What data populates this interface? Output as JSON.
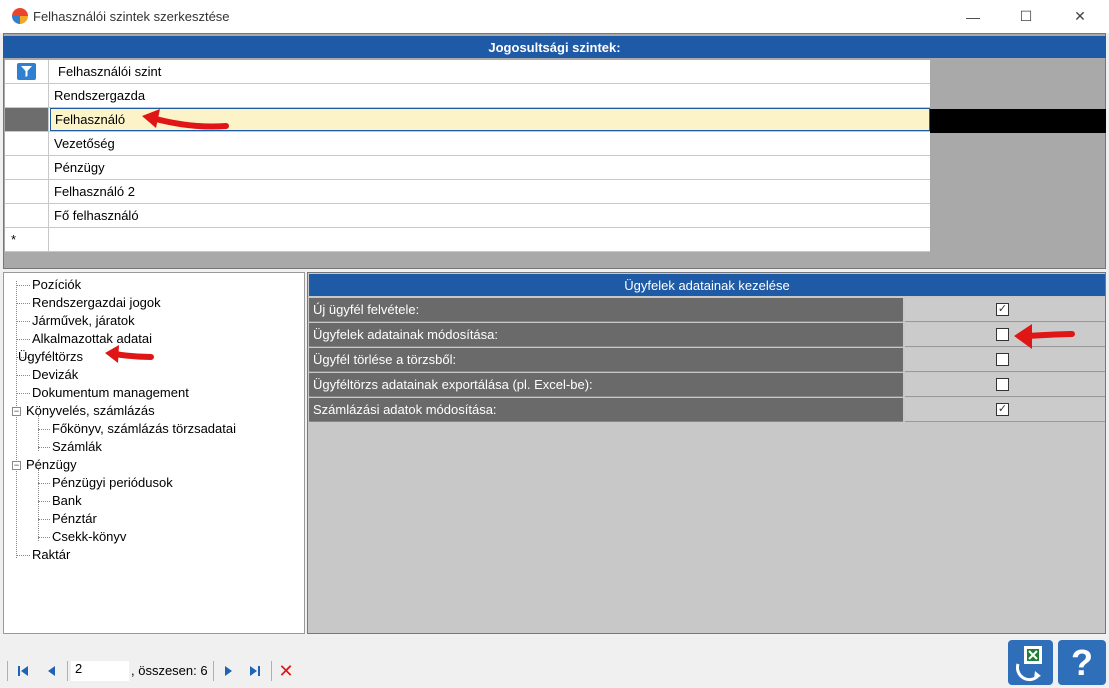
{
  "window": {
    "title": "Felhasználói szintek szerkesztése",
    "minimize_glyph": "—",
    "maximize_glyph": "☐",
    "close_glyph": "✕"
  },
  "grid": {
    "header": "Jogosultsági szintek:",
    "column_header": "Felhasználói szint",
    "rows": [
      "Rendszergazda",
      "Felhasználó",
      "Vezetőség",
      "Pénzügy",
      "Felhasználó 2",
      "Fő felhasználó"
    ],
    "selected_index": 1,
    "new_row_marker": "*"
  },
  "tree": {
    "items": [
      {
        "label": "Pozíciók",
        "level": 0
      },
      {
        "label": "Rendszergazdai jogok",
        "level": 0
      },
      {
        "label": "Járművek, járatok",
        "level": 0
      },
      {
        "label": "Alkalmazottak adatai",
        "level": 0
      },
      {
        "label": "Ügyféltörzs",
        "level": 0
      },
      {
        "label": "Devizák",
        "level": 0
      },
      {
        "label": "Dokumentum management",
        "level": 0
      },
      {
        "label": "Könyvelés, számlázás",
        "level": 0,
        "expanded": true
      },
      {
        "label": "Főkönyv, számlázás törzsadatai",
        "level": 1
      },
      {
        "label": "Számlák",
        "level": 1
      },
      {
        "label": "Pénzügy",
        "level": 0,
        "expanded": true
      },
      {
        "label": "Pénzügyi periódusok",
        "level": 1
      },
      {
        "label": "Bank",
        "level": 1
      },
      {
        "label": "Pénztár",
        "level": 1
      },
      {
        "label": "Csekk-könyv",
        "level": 1
      },
      {
        "label": "Raktár",
        "level": 0
      }
    ]
  },
  "permissions": {
    "header": "Ügyfelek adatainak kezelése",
    "rows": [
      {
        "label": "Új ügyfél felvétele:",
        "checked": true
      },
      {
        "label": "Ügyfelek adatainak módosítása:",
        "checked": false
      },
      {
        "label": "Ügyfél törlése a törzsből:",
        "checked": false
      },
      {
        "label": "Ügyféltörzs adatainak exportálása (pl. Excel-be):",
        "checked": false
      },
      {
        "label": "Számlázási adatok módosítása:",
        "checked": true
      }
    ]
  },
  "navigator": {
    "position": "2",
    "count_text": ", összesen: 6",
    "delete_glyph": "✕"
  },
  "help_glyph": "?",
  "colors": {
    "accent": "#1f5aa6",
    "selected_row": "#fdf3c8",
    "annotation_arrow": "#e01515"
  }
}
